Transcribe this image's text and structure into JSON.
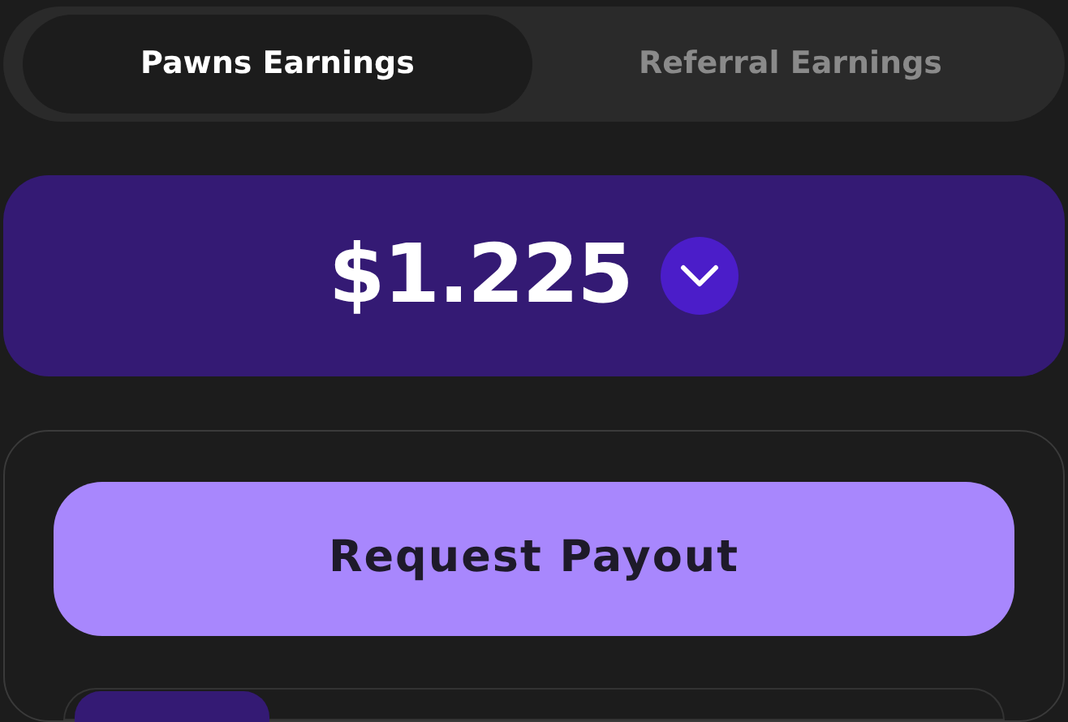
{
  "tabs": [
    {
      "label": "Pawns Earnings",
      "selected": true
    },
    {
      "label": "Referral Earnings",
      "selected": false
    }
  ],
  "balance": {
    "amount": "$1.225",
    "expanded": false
  },
  "payout_button": {
    "label": "Request Payout"
  }
}
